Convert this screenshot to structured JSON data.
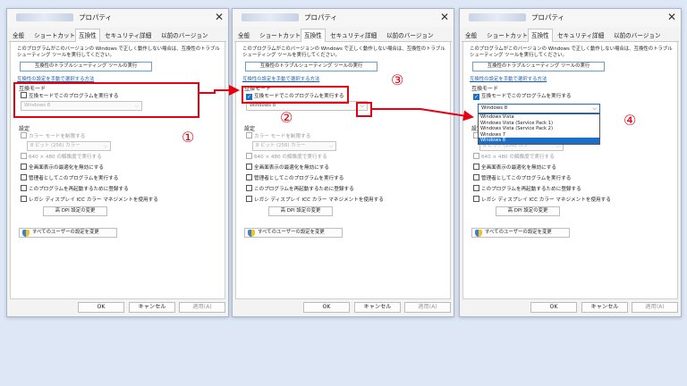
{
  "dialog": {
    "title": "プロパティ",
    "close": "✕",
    "tabs": [
      "全般",
      "ショートカット",
      "互換性",
      "セキュリティ",
      "詳細",
      "以前のバージョン"
    ],
    "intro": "このプログラムがこのバージョンの Windows で正しく動作しない場合は、互換性のトラブルシューティング ツールを実行してください。",
    "troubleshoot_button": "互換性のトラブルシューティング ツールの実行",
    "manual_link": "互換性の設定を手動で選択する方法",
    "compat_group": "互換モード",
    "compat_check": "互換モードでこのプログラムを実行する",
    "os_value": "Windows 8",
    "settings_group": "設定",
    "settings": [
      "カラー モードを制限する",
      "8 ビット (256) カラー",
      "640 × 480 の解像度で実行する",
      "全画面表示の最適化を無効にする",
      "管理者としてこのプログラムを実行する",
      "このプログラムを再起動するために登録する",
      "レガシ ディスプレイ ICC カラー マネジメントを使用する"
    ],
    "dpi_button": "高 DPI 設定の変更",
    "all_users_button": "すべてのユーザーの設定を変更",
    "ok": "OK",
    "cancel": "キャンセル",
    "apply": "適用(A)"
  },
  "dropdown_options": [
    "Windows Vista",
    "Windows Vista (Service Pack 1)",
    "Windows Vista (Service Pack 2)",
    "Windows 7",
    "Windows 8"
  ],
  "dropdown_selected": "Windows 8",
  "steps": [
    "①",
    "②",
    "③",
    "④"
  ],
  "colors": {
    "annotation": "#e60012",
    "accent": "#1a6fc9",
    "background": "#dde7f6"
  }
}
